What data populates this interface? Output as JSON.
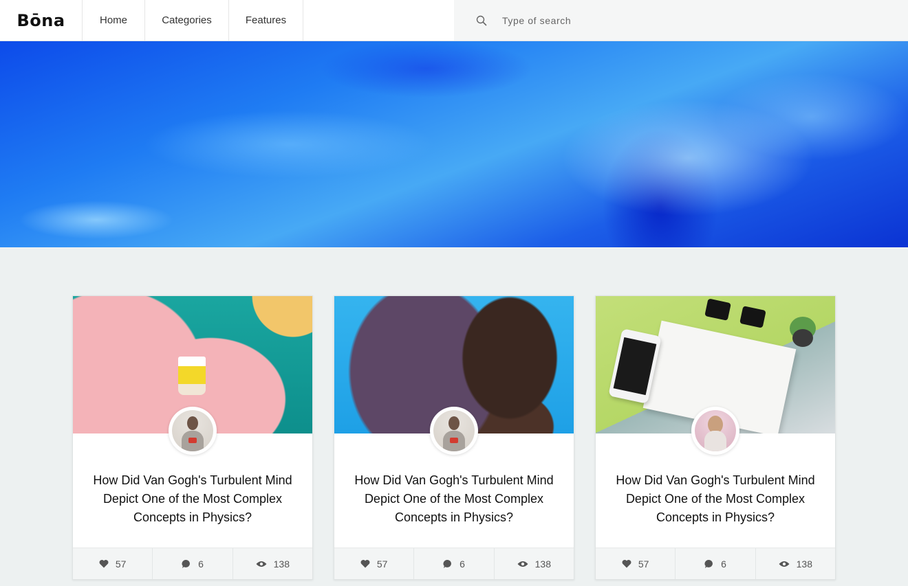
{
  "header": {
    "logo": "Bōna",
    "nav": [
      {
        "label": "Home"
      },
      {
        "label": "Categories"
      },
      {
        "label": "Features"
      }
    ],
    "search": {
      "placeholder": "Type of search",
      "icon": "search-icon"
    }
  },
  "hero": {
    "image": "blue-marble-fluid-art"
  },
  "cards": [
    {
      "title": "How Did Van Gogh's Turbulent Mind Depict One of the Most Complex Concepts in Physics?",
      "image": "hand-holding-cup-on-painted-wall",
      "likes": "57",
      "comments": "6",
      "views": "138"
    },
    {
      "title": "How Did Van Gogh's Turbulent Mind Depict One of the Most Complex Concepts in Physics?",
      "image": "woman-in-headscarf-on-blue",
      "likes": "57",
      "comments": "6",
      "views": "138"
    },
    {
      "title": "How Did Van Gogh's Turbulent Mind Depict One of the Most Complex Concepts in Physics?",
      "image": "phone-notebook-sunglasses-flatlay",
      "likes": "57",
      "comments": "6",
      "views": "138"
    }
  ],
  "colors": {
    "accent": "#1f7cf3",
    "page_bg": "#edf1f1",
    "stats_bg": "#f3f5f5"
  }
}
